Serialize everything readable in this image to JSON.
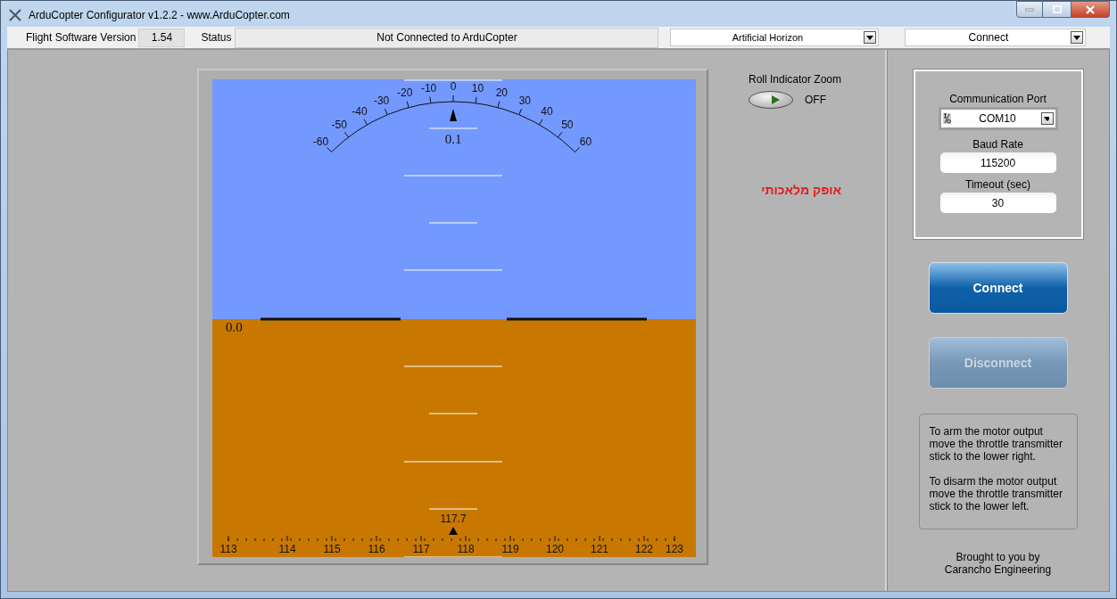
{
  "window": {
    "title": "ArduCopter Configurator v1.2.2 - www.ArduCopter.com"
  },
  "toolbar": {
    "version_label": "Flight Software Version",
    "version_value": "1.54",
    "status_label": "Status",
    "status_value": "Not Connected to ArduCopter",
    "view_select": "Artificial Horizon",
    "mode_select": "Connect"
  },
  "horizon": {
    "roll_scale": [
      "-60",
      "-50",
      "-40",
      "-30",
      "-20",
      "-10",
      "0",
      "10",
      "20",
      "30",
      "40",
      "50",
      "60"
    ],
    "roll_reading": "0.1",
    "pitch_reading": "0.0",
    "heading_reading": "117.7",
    "heading_scale": [
      "113",
      "114",
      "115",
      "116",
      "117",
      "118",
      "119",
      "120",
      "121",
      "122",
      "123"
    ]
  },
  "roll_zoom": {
    "label": "Roll Indicator Zoom",
    "on": false,
    "state_text": "OFF"
  },
  "horizon_caption": "אופק מלאכותי",
  "connection": {
    "port_label": "Communication Port",
    "port_value": "COM10",
    "baud_label": "Baud Rate",
    "baud_value": "115200",
    "timeout_label": "Timeout (sec)",
    "timeout_value": "30"
  },
  "buttons": [
    {
      "label": "Connect",
      "disabled": false
    },
    {
      "label": "Disconnect",
      "disabled": true
    }
  ],
  "instructions": [
    "To arm the motor output move the throttle transmitter stick to the lower right.",
    "To disarm the motor output move the throttle transmitter stick to the lower left."
  ],
  "credit": [
    "Brought to you by",
    "Carancho Engineering"
  ]
}
